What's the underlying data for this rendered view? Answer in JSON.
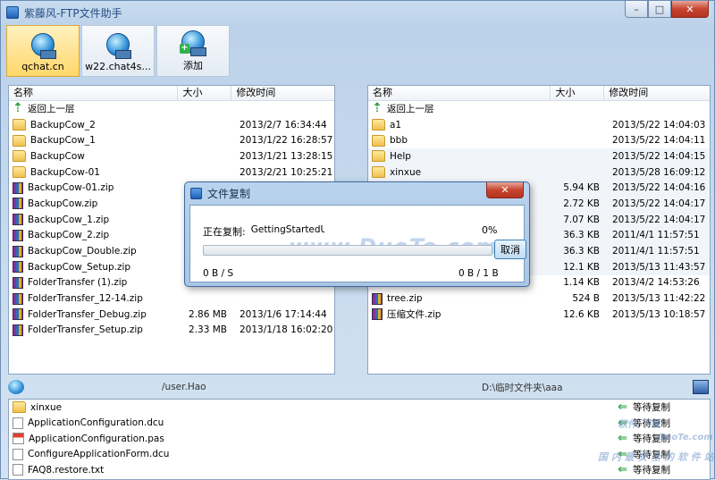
{
  "window": {
    "title": "紫藤风-FTP文件助手",
    "buttons": {
      "minimize": "–",
      "maximize": "□",
      "close": "✕"
    }
  },
  "toolbar": [
    {
      "label": "qchat.cn",
      "active": true
    },
    {
      "label": "w22.chat4s...",
      "active": false
    },
    {
      "label": "添加",
      "active": false
    }
  ],
  "columns": {
    "name": "名称",
    "size": "大小",
    "time": "修改时间"
  },
  "left_pane": {
    "path": "/user.Hao",
    "rows": [
      {
        "icon": "up",
        "name": "返回上一层",
        "size": "",
        "time": ""
      },
      {
        "icon": "folder",
        "name": "BackupCow_2",
        "size": "",
        "time": "2013/2/7 16:34:44"
      },
      {
        "icon": "folder",
        "name": "BackupCow_1",
        "size": "",
        "time": "2013/1/22 16:28:57"
      },
      {
        "icon": "folder",
        "name": "BackupCow",
        "size": "",
        "time": "2013/1/21 13:28:15"
      },
      {
        "icon": "folder",
        "name": "BackupCow-01",
        "size": "",
        "time": "2013/2/21 10:25:21"
      },
      {
        "icon": "zip",
        "name": "BackupCow-01.zip",
        "size": "",
        "time": ""
      },
      {
        "icon": "zip",
        "name": "BackupCow.zip",
        "size": "",
        "time": ""
      },
      {
        "icon": "zip",
        "name": "BackupCow_1.zip",
        "size": "",
        "time": ""
      },
      {
        "icon": "zip",
        "name": "BackupCow_2.zip",
        "size": "",
        "time": ""
      },
      {
        "icon": "zip",
        "name": "BackupCow_Double.zip",
        "size": "",
        "time": ""
      },
      {
        "icon": "zip",
        "name": "BackupCow_Setup.zip",
        "size": "",
        "time": ""
      },
      {
        "icon": "zip",
        "name": "FolderTransfer (1).zip",
        "size": "",
        "time": ""
      },
      {
        "icon": "zip",
        "name": "FolderTransfer_12-14.zip",
        "size": "",
        "time": ""
      },
      {
        "icon": "zip",
        "name": "FolderTransfer_Debug.zip",
        "size": "2.86 MB",
        "time": "2013/1/6 17:14:44"
      },
      {
        "icon": "zip",
        "name": "FolderTransfer_Setup.zip",
        "size": "2.33 MB",
        "time": "2013/1/18 16:02:20"
      }
    ]
  },
  "right_pane": {
    "path": "D:\\临时文件夹\\aaa",
    "rows": [
      {
        "icon": "up",
        "name": "返回上一层",
        "size": "",
        "time": ""
      },
      {
        "icon": "folder",
        "name": "a1",
        "size": "",
        "time": "2013/5/22 14:04:03"
      },
      {
        "icon": "folder",
        "name": "bbb",
        "size": "",
        "time": "2013/5/22 14:04:11"
      },
      {
        "icon": "folder",
        "name": "Help",
        "size": "",
        "time": "2013/5/22 14:04:15"
      },
      {
        "icon": "folder",
        "name": "xinxue",
        "size": "",
        "time": "2013/5/28 16:09:12"
      },
      {
        "icon": "",
        "name": "",
        "size": "5.94 KB",
        "time": "2013/5/22 14:04:16"
      },
      {
        "icon": "",
        "name": "",
        "size": "2.72 KB",
        "time": "2013/5/22 14:04:17"
      },
      {
        "icon": "",
        "name": "",
        "size": "7.07 KB",
        "time": "2013/5/22 14:04:17"
      },
      {
        "icon": "",
        "name": "",
        "size": "36.3 KB",
        "time": "2011/4/1 11:57:51"
      },
      {
        "icon": "",
        "name": "",
        "size": "36.3 KB",
        "time": "2011/4/1 11:57:51"
      },
      {
        "icon": "",
        "name": "",
        "size": "12.1 KB",
        "time": "2013/5/13 11:43:57"
      },
      {
        "icon": "",
        "name": "",
        "size": "1.14 KB",
        "time": "2013/4/2 14:53:26"
      },
      {
        "icon": "zip",
        "name": "tree.zip",
        "size": "524 B",
        "time": "2013/5/13 11:42:22"
      },
      {
        "icon": "zip",
        "name": "压缩文件.zip",
        "size": "12.6 KB",
        "time": "2013/5/13 10:18:57"
      }
    ]
  },
  "queue": [
    {
      "icon": "folder",
      "name": "xinxue",
      "status": "等待复制"
    },
    {
      "icon": "file",
      "name": "ApplicationConfiguration.dcu",
      "status": "等待复制"
    },
    {
      "icon": "pas",
      "name": "ApplicationConfiguration.pas",
      "status": "等待复制"
    },
    {
      "icon": "file",
      "name": "ConfigureApplicationForm.dcu",
      "status": "等待复制"
    },
    {
      "icon": "file",
      "name": "FAQ8.restore.txt",
      "status": "等待复制"
    }
  ],
  "dialog": {
    "title": "文件复制",
    "close": "✕",
    "copying_label": "正在复制:",
    "file": "GettingStartedUs",
    "percent": "0%",
    "progress": 0,
    "speed": "0 B / S",
    "bytes": "0 B / 1 B",
    "cancel": "取消",
    "watermark": "www.DuoTe.com"
  },
  "watermarks": {
    "site": "软件 下载",
    "url": "DuoTe.com",
    "bottom": "国 内 最 安 全 的 软 件 站"
  }
}
